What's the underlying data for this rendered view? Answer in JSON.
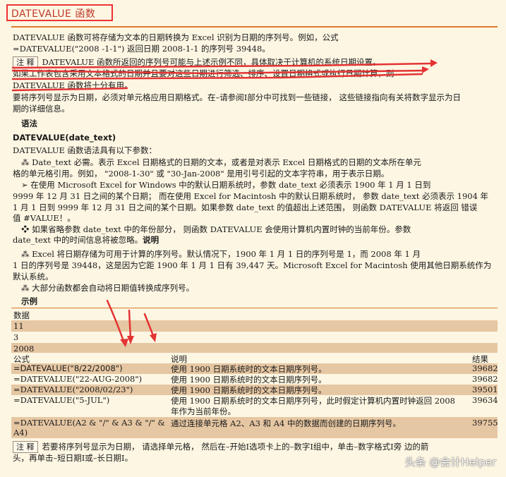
{
  "title": "DATEVALUE 函数",
  "intro": {
    "line1": "DATEVALUE 函数可将存储为文本的日期转换为  Excel 识别为日期的序列号。例如，公式",
    "line2": "=DATEVALUE(\"2008 -1-1\") 返回日期 2008-1-1 的序列号  39448。"
  },
  "note1": {
    "tag": "注 释",
    "line1": "DATEVALUE 函数所返回的序列号可能与上述示例不同，具体取决于计算机的系统日期设置。",
    "line2": "如果工作表包含采用文本格式的日期并且要对这些日期进行筛选、排序、设置日期格式或执行日期计算，则",
    "line3": "DATEVALUE 函数将十分有用。",
    "line4": "要将序列号显示为日期，必须对单元格应用日期格式。在–请参阅I部分中可找到一些链接，  这些链接指向有关将数字显示为日",
    "line5": "期的详细信息。"
  },
  "syntax_heading": "语法",
  "syntax": "DATEVALUE(date_text)",
  "args_intro": "DATEVALUE 函数语法具有以下参数：",
  "args": {
    "a1": "⁂ Date_text   必需。表示 Excel 日期格式的日期的文本，或者是对表示  Excel 日期格式的日期的文本所在单元",
    "a2": "格的单元格引用。例如，  \"2008-1-30\" 或  \"30-Jan-2008\" 是用引号引起的文本字符串，用于表示日期。",
    "a3": "➢ 在使用  Microsoft Excel for Windows 中的默认日期系统时，参数  date_text 必须表示  1900 年  1 月  1 日到",
    "a4": "9999 年  12 月  31 日之间的某个日期；  而在使用 Excel for Macintosh 中的默认日期系统时，  参数 date_text 必须表示  1904 年",
    "a5": "1 月  1 日到 9999 年  12 月  31 日之间的某个日期。如果参数 date_text 的值超出上述范围，  则函数 DATEVALUE 将返回 错误",
    "a6": "值 #VALUE！。",
    "a7": "❖ 如果省略参数  date_text 中的年份部分，  则函数 DATEVALUE 会使用计算机内置时钟的当前年份。参数",
    "a8_text": "date_text 中的时间信息将被忽略。",
    "a8_bold": "说明"
  },
  "remarks": {
    "r1": "⁂ Excel 将日期存储为可用于计算的序列号。默认情况下，1900 年  1 月  1 日的序列号是  1，而  2008 年  1 月",
    "r2": "1 日的序列号是  39448，这是因为它距  1900 年 1 月 1 日有 39,447 天。Microsoft Excel for Macintosh 使用其他日期系统作为",
    "r3": "默认系统。",
    "r4": "⁂ 大部分函数都会自动将日期值转换成序列号。"
  },
  "example_heading": "示例",
  "data_table": {
    "header": "数据",
    "rows": [
      "11",
      "3",
      "2008"
    ]
  },
  "formula_table": {
    "headers": [
      "公式",
      "说明",
      "结果"
    ],
    "rows": [
      {
        "formula": "=DATEVALUE(\"8/22/2008\")",
        "desc": "使用  1900 日期系统时的文本日期序列号。",
        "result": "39682"
      },
      {
        "formula": "=DATEVALUE(\"22-AUG-2008\")",
        "desc": "使用  1900 日期系统时的文本日期序列号。",
        "result": "39682"
      },
      {
        "formula": "=DATEVALUE(\"2008/02/23\")",
        "desc": "使用  1900 日期系统时的文本日期序列号。",
        "result": "39501"
      },
      {
        "formula": "=DATEVALUE(\"5-JUL\")",
        "desc": "使用  1900 日期系统时的文本日期序列号，此时假定计算机内置时钟返回  2008",
        "desc2": "年作为当前年份。",
        "result": "39634"
      },
      {
        "formula": "=DATEVALUE(A2 & \"/\" & A3 & \"/\" &",
        "formula2": "A4)",
        "desc": "通过连接单元格  A2、A3 和  A4 中的数据而创建的日期序列号。",
        "result": "39755"
      }
    ]
  },
  "note2": {
    "tag": "注 释",
    "line1": "若要将序列号显示为日期，  请选择单元格，  然后在–开始I选项卡上的–数字I组中，单击–数字格式I旁       边的箭",
    "line2": "头，再单击–短日期I或–长日期I。"
  },
  "watermark": "头条 @会计Helper",
  "colors": {
    "accent": "#d97a2b",
    "annotation": "#e33333",
    "band": "#e6c7a3",
    "paper": "#fdf6e3"
  }
}
